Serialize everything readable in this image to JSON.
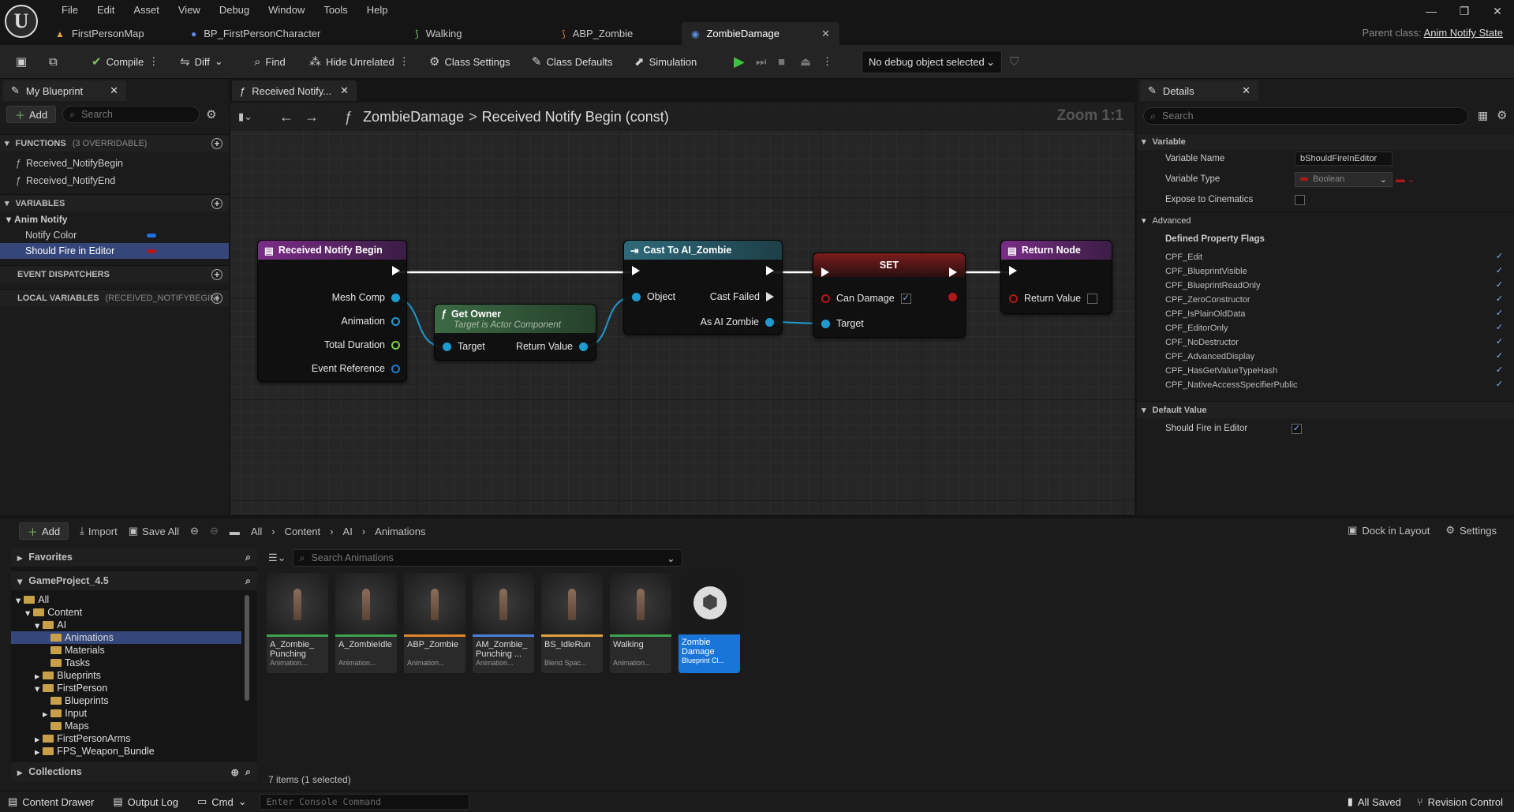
{
  "menu": [
    "File",
    "Edit",
    "Asset",
    "View",
    "Debug",
    "Window",
    "Tools",
    "Help"
  ],
  "doc_tabs": [
    {
      "label": "FirstPersonMap",
      "icon": "map-icon",
      "color": "#e0a040"
    },
    {
      "label": "BP_FirstPersonCharacter",
      "icon": "character-icon",
      "color": "#5b8ee0"
    },
    {
      "label": "Walking",
      "icon": "animation-icon",
      "color": "#7cc46a"
    },
    {
      "label": "ABP_Zombie",
      "icon": "anim-blueprint-icon",
      "color": "#e07a3c"
    },
    {
      "label": "ZombieDamage",
      "icon": "anim-notify-icon",
      "color": "#5b8ee0"
    }
  ],
  "parent_class": {
    "label": "Parent class:",
    "value": "Anim Notify State"
  },
  "toolbar": {
    "compile": "Compile",
    "diff": "Diff",
    "find": "Find",
    "hide_unrelated": "Hide Unrelated",
    "class_settings": "Class Settings",
    "class_defaults": "Class Defaults",
    "simulation": "Simulation",
    "debug_object": "No debug object selected"
  },
  "my_blueprint": {
    "tab": "My Blueprint",
    "add": "Add",
    "search_placeholder": "Search",
    "functions_header": "FUNCTIONS",
    "functions_sub": "(3 OVERRIDABLE)",
    "functions": [
      "Received_NotifyBegin",
      "Received_NotifyEnd"
    ],
    "variables_header": "VARIABLES",
    "var_category": "Anim Notify",
    "variables": [
      {
        "name": "Notify Color",
        "color": "#1f6fe0"
      },
      {
        "name": "Should Fire in Editor",
        "color": "#b01818"
      }
    ],
    "event_dispatchers": "EVENT DISPATCHERS",
    "local_vars": "LOCAL VARIABLES",
    "local_vars_sub": "(RECEIVED_NOTIFYBEGIN)"
  },
  "graph": {
    "tab": "Received Notify...",
    "breadcrumb_root": "ZombieDamage",
    "breadcrumb_sep": ">",
    "breadcrumb_fn": "Received Notify Begin (const)",
    "zoom": "Zoom 1:1",
    "nodes": {
      "received": {
        "title": "Received Notify Begin",
        "pins": [
          "Mesh Comp",
          "Animation",
          "Total Duration",
          "Event Reference"
        ]
      },
      "get_owner": {
        "title": "Get Owner",
        "subtitle": "Target is Actor Component",
        "in": "Target",
        "out": "Return Value"
      },
      "cast": {
        "title": "Cast To AI_Zombie",
        "object": "Object",
        "failed": "Cast Failed",
        "as": "As AI Zombie"
      },
      "set": {
        "title": "SET",
        "var": "Can Damage",
        "target": "Target"
      },
      "ret": {
        "title": "Return Node",
        "val": "Return Value"
      }
    }
  },
  "details": {
    "tab": "Details",
    "search_placeholder": "Search",
    "variable_section": "Variable",
    "var_name_label": "Variable Name",
    "var_name": "bShouldFireInEditor",
    "var_type_label": "Variable Type",
    "var_type": "Boolean",
    "expose_label": "Expose to Cinematics",
    "advanced": "Advanced",
    "flags_header": "Defined Property Flags",
    "flags": [
      "CPF_Edit",
      "CPF_BlueprintVisible",
      "CPF_BlueprintReadOnly",
      "CPF_ZeroConstructor",
      "CPF_IsPlainOldData",
      "CPF_EditorOnly",
      "CPF_NoDestructor",
      "CPF_AdvancedDisplay",
      "CPF_HasGetValueTypeHash",
      "CPF_NativeAccessSpecifierPublic"
    ],
    "default_section": "Default Value",
    "default_label": "Should Fire in Editor"
  },
  "content_browser": {
    "add": "Add",
    "import": "Import",
    "save_all": "Save All",
    "path": [
      "All",
      "Content",
      "AI",
      "Animations"
    ],
    "dock": "Dock in Layout",
    "settings": "Settings",
    "favorites": "Favorites",
    "project": "GameProject_4.5",
    "tree": [
      "All",
      "Content",
      "AI",
      "Animations",
      "Materials",
      "Tasks",
      "Blueprints",
      "FirstPerson",
      "Blueprints",
      "Input",
      "Maps",
      "FirstPersonArms",
      "FPS_Weapon_Bundle"
    ],
    "collections": "Collections",
    "search_placeholder": "Search Animations",
    "assets": [
      {
        "name": "A_Zombie_ Punching",
        "type": "Animation...",
        "bar": "#3fa34d"
      },
      {
        "name": "A_ZombieIdle",
        "type": "Animation...",
        "bar": "#3fa34d"
      },
      {
        "name": "ABP_Zombie",
        "type": "Animation...",
        "bar": "#e0852a"
      },
      {
        "name": "AM_Zombie_ Punching ...",
        "type": "Animation...",
        "bar": "#4a7fd8"
      },
      {
        "name": "BS_IdleRun",
        "type": "Blend Spac...",
        "bar": "#e0a040"
      },
      {
        "name": "Walking",
        "type": "Animation...",
        "bar": "#3fa34d"
      },
      {
        "name": "Zombie Damage",
        "type": "Blueprint Cl...",
        "bar": "#1976d8"
      }
    ],
    "count": "7 items (1 selected)"
  },
  "status": {
    "content_drawer": "Content Drawer",
    "output_log": "Output Log",
    "cmd": "Cmd",
    "console_placeholder": "Enter Console Command",
    "all_saved": "All Saved",
    "revision": "Revision Control"
  }
}
